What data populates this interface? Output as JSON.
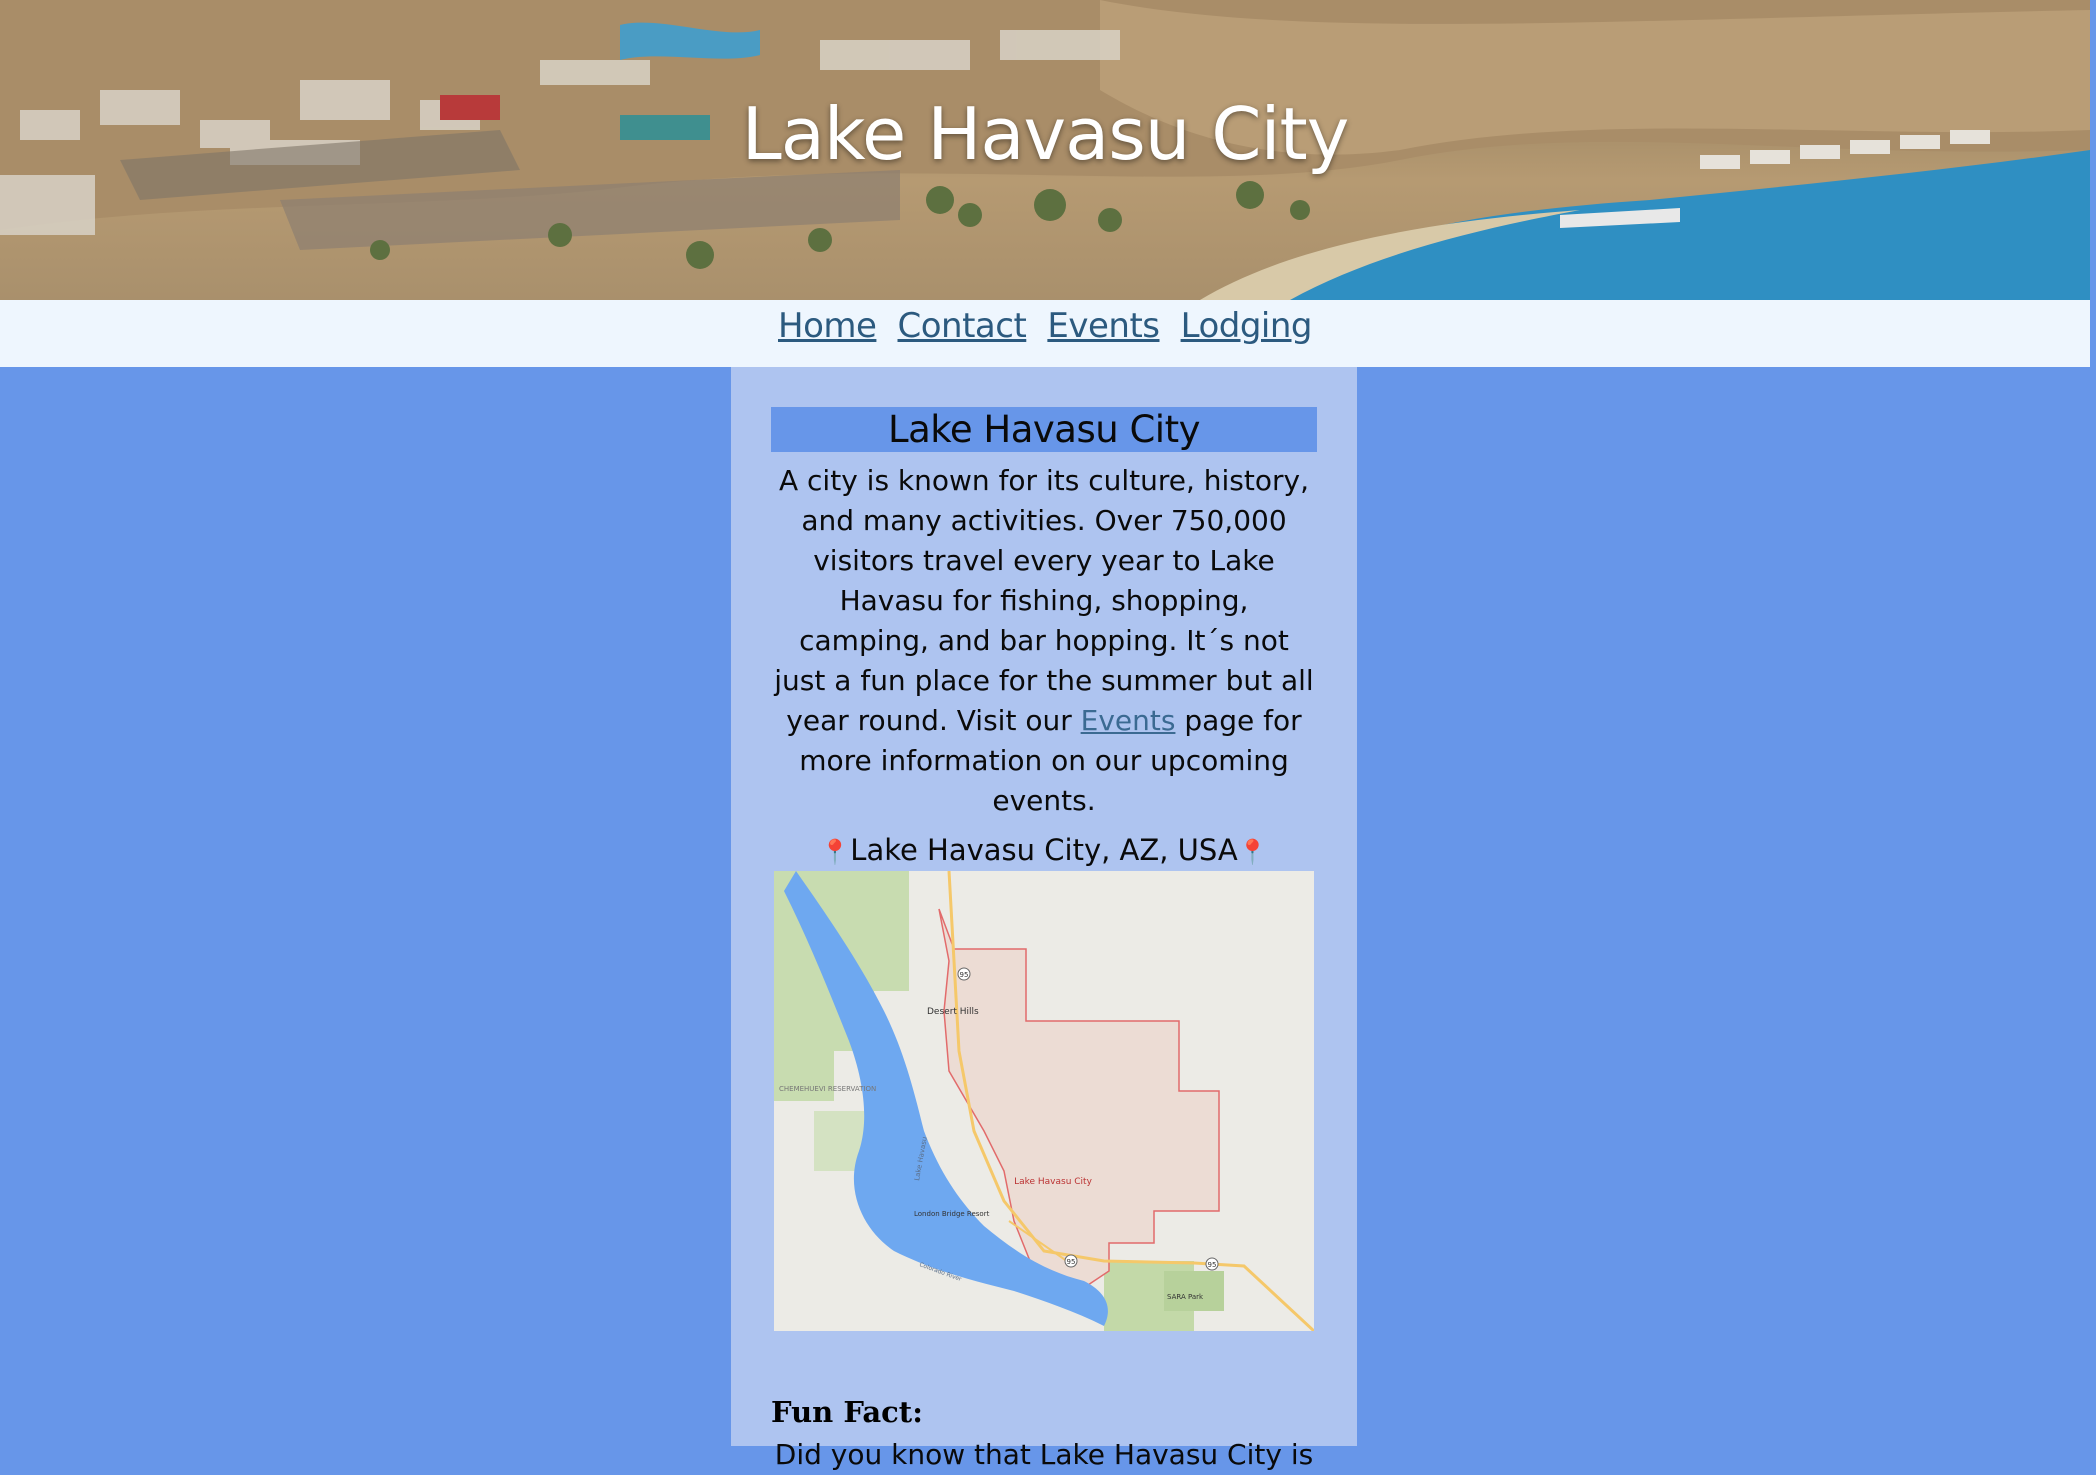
{
  "header": {
    "title": "Lake Havasu City"
  },
  "nav": {
    "items": [
      {
        "label": "Home"
      },
      {
        "label": "Contact"
      },
      {
        "label": "Events"
      },
      {
        "label": "Lodging"
      }
    ]
  },
  "main": {
    "section_title": "Lake Havasu City",
    "intro_before_link": "A city is known for its culture, history, and many activities. Over 750,000 visitors travel every year to Lake Havasu for fishing, shopping, camping, and bar hopping. It´s not just a fun place for the summer but all year round. Visit our",
    "intro_link": "Events",
    "intro_after_link": "page for more information on our upcoming events.",
    "location_label": "Lake Havasu City, AZ, USA",
    "location_pin": "📍",
    "map": {
      "labels": {
        "city": "Lake Havasu City",
        "desert_hills": "Desert Hills",
        "reservation": "CHEMEHUEVI RESERVATION",
        "lake": "Lake Havasu",
        "resort": "London Bridge Resort",
        "park": "SARA Park",
        "route": "95",
        "colorado_river": "Colorado River"
      }
    },
    "fun_fact_heading": "Fun Fact:",
    "fun_fact_text": "Did you know that Lake Havasu City is"
  },
  "colors": {
    "page_background": "#6796e9",
    "content_background": "#aec4f0",
    "nav_background": "#eef6fe",
    "link": "#2c5a7f"
  }
}
